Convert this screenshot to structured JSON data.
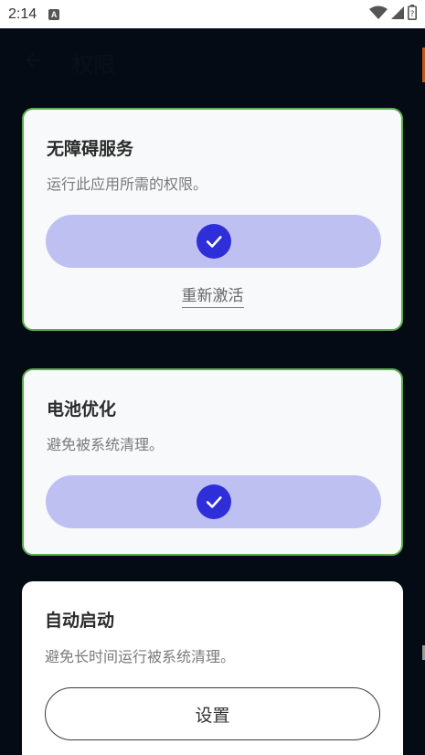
{
  "status_bar": {
    "time": "2:14",
    "notification_badge": "A",
    "icons": [
      "wifi-icon",
      "signal-icon",
      "battery-icon"
    ]
  },
  "app_bar": {
    "title": "权限",
    "back_icon": "arrow-back-icon"
  },
  "cards": [
    {
      "title": "无障碍服务",
      "description": "运行此应用所需的权限。",
      "status": "granted",
      "link_label": "重新激活"
    },
    {
      "title": "电池优化",
      "description": "避免被系统清理。",
      "status": "granted"
    },
    {
      "title": "自动启动",
      "description": "避免长时间运行被系统清理。",
      "button_label": "设置"
    }
  ],
  "colors": {
    "background": "#050b14",
    "card": "#f7f9fa",
    "card_border_granted": "#5dac4c",
    "granted_pill": "#bfc0f2",
    "check": "#2e2fd8"
  }
}
